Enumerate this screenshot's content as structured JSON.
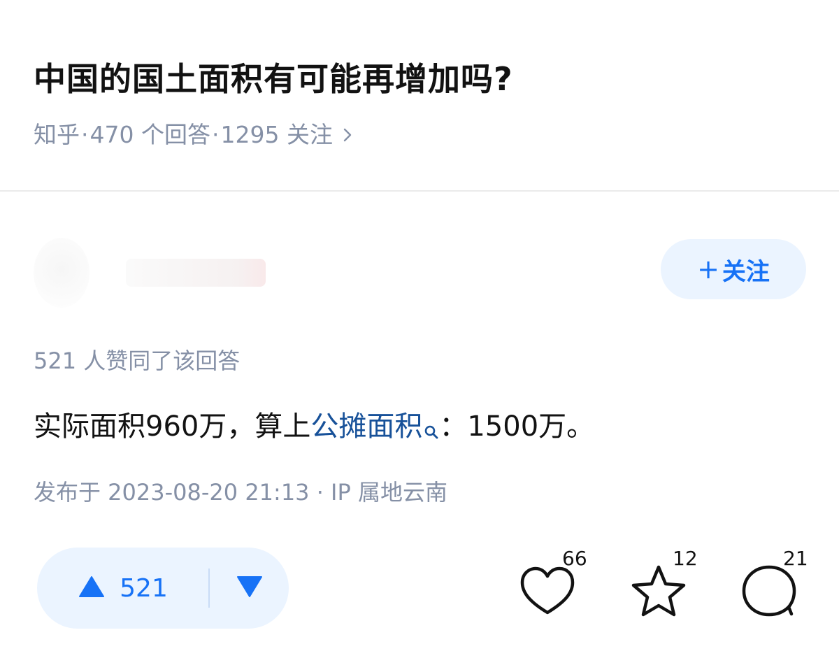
{
  "question": {
    "title": "中国的国土面积有可能再增加吗?",
    "source": "知乎",
    "answer_count": "470 个回答",
    "follower_count": "1295 关注"
  },
  "author": {
    "follow_label": "关注"
  },
  "answer": {
    "agree_summary": "521 人赞同了该回答",
    "text_before": "实际面积960万，算上",
    "link_text": "公摊面积",
    "text_after": "：1500万。",
    "publish_info": "发布于 2023-08-20 21:13 · IP 属地云南"
  },
  "actions": {
    "upvote_count": "521",
    "like_count": "66",
    "favorite_count": "12",
    "comment_count": "21"
  },
  "colors": {
    "brand_blue": "#1772f6",
    "link_blue": "#175199",
    "meta_gray": "#8590a6",
    "button_bg": "#ebf4ff"
  },
  "icons": [
    "chevron-right-icon",
    "plus-icon",
    "search-icon",
    "upvote-triangle-icon",
    "downvote-triangle-icon",
    "heart-icon",
    "star-icon",
    "comment-icon"
  ]
}
